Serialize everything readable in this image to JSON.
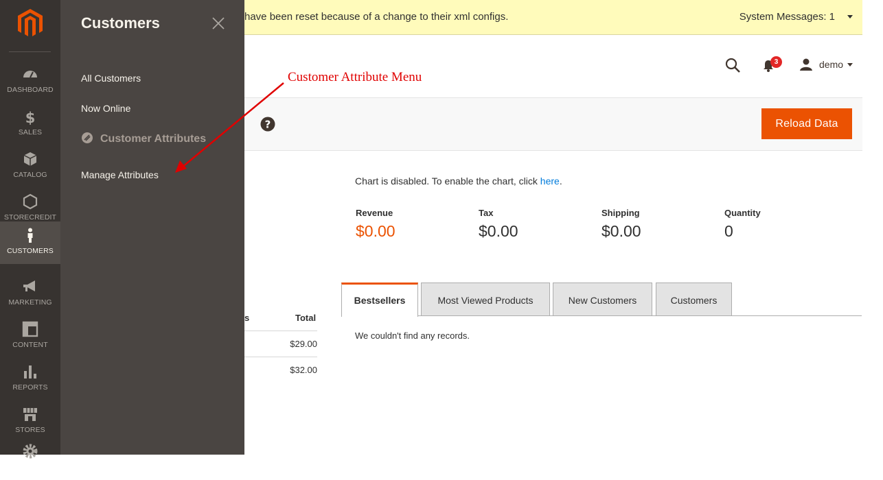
{
  "nav": {
    "items": [
      {
        "label": "DASHBOARD",
        "icon": "dashboard-icon"
      },
      {
        "label": "SALES",
        "icon": "dollar-icon"
      },
      {
        "label": "CATALOG",
        "icon": "box-icon"
      },
      {
        "label": "STORECREDIT",
        "icon": "hexagon-icon"
      },
      {
        "label": "CUSTOMERS",
        "icon": "person-icon",
        "active": true
      },
      {
        "label": "MARKETING",
        "icon": "megaphone-icon"
      },
      {
        "label": "CONTENT",
        "icon": "layout-icon"
      },
      {
        "label": "REPORTS",
        "icon": "bar-chart-icon"
      },
      {
        "label": "STORES",
        "icon": "store-icon"
      },
      {
        "label": "",
        "icon": "gear-icon"
      }
    ]
  },
  "flyout": {
    "title": "Customers",
    "links": [
      "All Customers",
      "Now Online"
    ],
    "group": "Customer Attributes",
    "group_links": [
      "Manage Attributes"
    ]
  },
  "message": {
    "text": "have been reset because of a change to their xml configs.",
    "system": "System Messages: 1"
  },
  "header": {
    "notifications": "3",
    "user": "demo"
  },
  "actions": {
    "reload": "Reload Data"
  },
  "dashboard": {
    "chart_msg": "Chart is disabled. To enable the chart, click ",
    "chart_link": "here",
    "chart_msg_end": ".",
    "stats": [
      {
        "label": "Revenue",
        "value": "$0.00",
        "accent": true
      },
      {
        "label": "Tax",
        "value": "$0.00"
      },
      {
        "label": "Shipping",
        "value": "$0.00"
      },
      {
        "label": "Quantity",
        "value": "0"
      }
    ],
    "tabs": [
      "Bestsellers",
      "Most Viewed Products",
      "New Customers",
      "Customers"
    ],
    "no_records": "We couldn't find any records.",
    "table": {
      "col_partial": "s",
      "col_total": "Total",
      "rows": [
        "$29.00",
        "$32.00"
      ]
    }
  },
  "annotation": {
    "text": "Customer Attribute Menu",
    "color": "#e00000"
  }
}
